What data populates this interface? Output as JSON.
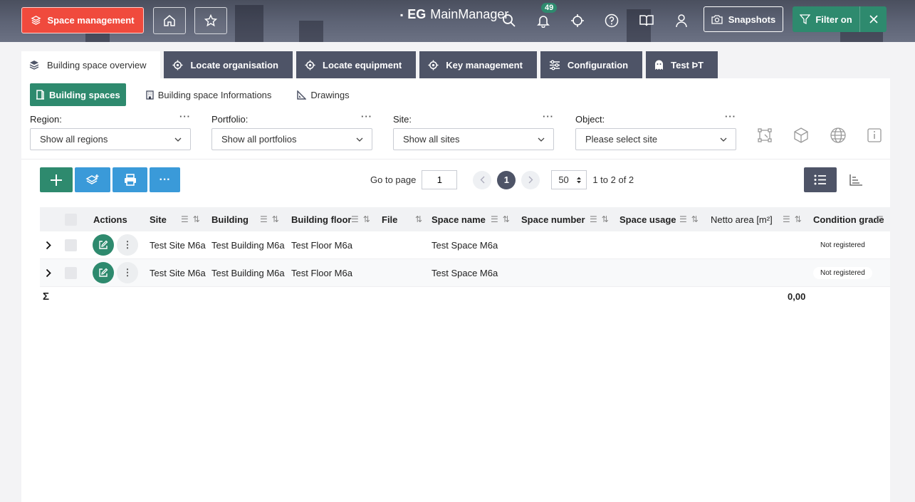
{
  "header": {
    "module_label": "Space management",
    "logo_mark": "EG",
    "logo_text": "MainManager",
    "notification_count": "49",
    "snapshots_label": "Snapshots",
    "filter_label": "Filter on"
  },
  "tabs": [
    {
      "label": "Building space overview",
      "icon": "layers-icon",
      "active": true
    },
    {
      "label": "Locate organisation",
      "icon": "locate-icon"
    },
    {
      "label": "Locate equipment",
      "icon": "locate-icon"
    },
    {
      "label": "Key management",
      "icon": "locate-icon"
    },
    {
      "label": "Configuration",
      "icon": "sliders-icon"
    },
    {
      "label": "Test ÞT",
      "icon": "ghost-icon"
    }
  ],
  "subtabs": [
    {
      "label": "Building spaces",
      "active": true
    },
    {
      "label": "Building space Informations"
    },
    {
      "label": "Drawings"
    }
  ],
  "filters": [
    {
      "label": "Region:",
      "value": "Show all regions"
    },
    {
      "label": "Portfolio:",
      "value": "Show all portfolios"
    },
    {
      "label": "Site:",
      "value": "Show all sites"
    },
    {
      "label": "Object:",
      "value": "Please select site"
    }
  ],
  "pager": {
    "go_to_label": "Go to page",
    "page_input": "1",
    "current_page": "1",
    "page_size": "50",
    "range_text": "1 to 2 of 2"
  },
  "grid": {
    "columns": [
      "Actions",
      "Site",
      "Building",
      "Building floor",
      "File",
      "Space name",
      "Space number",
      "Space usage",
      "Netto area [m²]",
      "Condition grade"
    ],
    "rows": [
      {
        "site": "Test Site M6a",
        "building": "Test Building M6a",
        "floor": "Test Floor M6a",
        "file": "",
        "space_name": "Test Space M6a",
        "space_number": "",
        "space_usage": "",
        "netto_area": "",
        "condition": "Not registered"
      },
      {
        "site": "Test Site M6a",
        "building": "Test Building M6a",
        "floor": "Test Floor M6a",
        "file": "",
        "space_name": "Test Space M6a",
        "space_number": "",
        "space_usage": "",
        "netto_area": "",
        "condition": "Not registered"
      }
    ],
    "sum_symbol": "Σ",
    "sum_netto_area": "0,00"
  },
  "colors": {
    "accent": "#2e8a6e",
    "module": "#f04a3d",
    "tab_dark": "#4e5467",
    "action_blue": "#3a9ad9"
  }
}
